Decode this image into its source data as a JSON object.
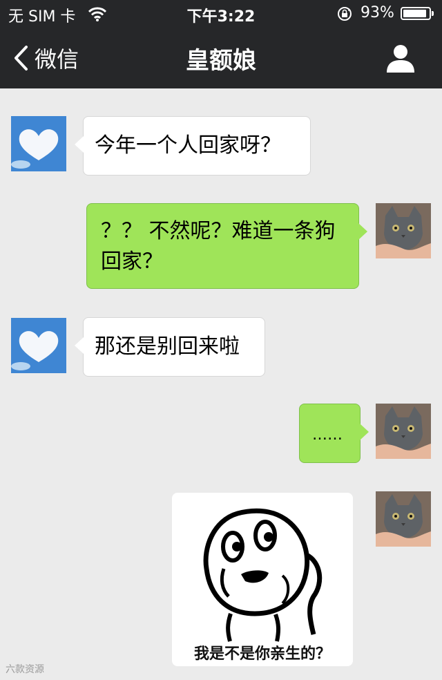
{
  "status_bar": {
    "carrier": "无 SIM 卡",
    "time": "下午3:22",
    "battery_percent": "93%",
    "battery_level": 0.93
  },
  "nav": {
    "back_label": "微信",
    "title": "皇额娘"
  },
  "messages": [
    {
      "side": "in",
      "avatar": "heart-cloud",
      "text": "今年一个人回家呀？"
    },
    {
      "side": "out",
      "avatar": "gray-cat",
      "text_line1": "？？ 不然呢？难道一条狗",
      "text_line2": "回家？"
    },
    {
      "side": "in",
      "avatar": "heart-cloud",
      "text": "那还是别回来啦"
    },
    {
      "side": "out",
      "avatar": "gray-cat",
      "text": "……"
    },
    {
      "side": "out",
      "avatar": "gray-cat",
      "type": "sticker",
      "caption": "我是不是你亲生的？"
    }
  ],
  "watermark": "六款资源",
  "colors": {
    "header_bg": "#262729",
    "chat_bg": "#ebebeb",
    "out_bubble": "#9fe459",
    "in_bubble": "#ffffff"
  }
}
